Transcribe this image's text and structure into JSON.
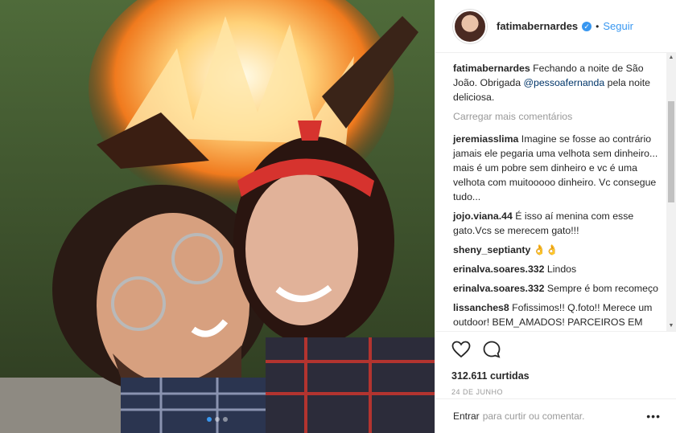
{
  "header": {
    "username": "fatimabernardes",
    "separator": "•",
    "follow_label": "Seguir"
  },
  "caption": {
    "username": "fatimabernardes",
    "text_before": "Fechando a noite de São João. Obrigada ",
    "mention": "@pessoafernanda",
    "text_after": " pela noite deliciosa."
  },
  "load_more": "Carregar mais comentários",
  "comments": [
    {
      "username": "jeremiasslima",
      "text": "Imagine se fosse ao contrário jamais ele pegaria uma velhota sem dinheiro... mais é um pobre sem dinheiro e vc é uma velhota com muitooooo dinheiro. Vc consegue tudo..."
    },
    {
      "username": "jojo.viana.44",
      "text": "É isso aí menina com esse gato.Vcs se merecem gato!!!"
    },
    {
      "username": "sheny_septianty",
      "text": "👌👌"
    },
    {
      "username": "erinalva.soares.332",
      "text": "Lindos"
    },
    {
      "username": "erinalva.soares.332",
      "text": "Sempre é bom recomeço"
    },
    {
      "username": "lissanches8",
      "text": "Fofissimos!! Q.foto!! Merece um outdoor! BEM_AMADOS! PARCEIROS EM TD, QUERIDINHOS DO BRASIL."
    }
  ],
  "likes": "312.611 curtidas",
  "date": "24 DE JUNHO",
  "add_comment": {
    "login_label": "Entrar",
    "rest": "para curtir ou comentar.",
    "more_label": "•••"
  },
  "carousel": {
    "count": 3,
    "active": 1
  },
  "colors": {
    "link": "#3897f0",
    "mention": "#003569",
    "muted": "#999999"
  }
}
